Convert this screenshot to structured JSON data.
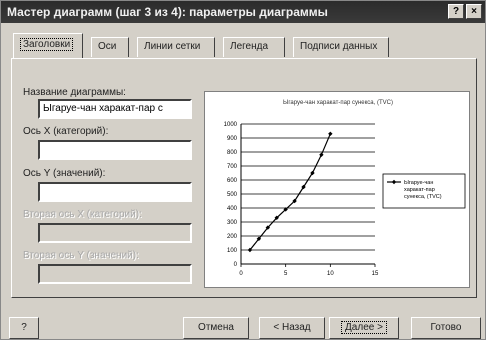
{
  "title": "Мастер диаграмм (шаг 3 из 4): параметры диаграммы",
  "title_buttons": {
    "help": "?",
    "close": "×"
  },
  "tabs": [
    {
      "label": "Заголовки",
      "active": true
    },
    {
      "label": "Оси"
    },
    {
      "label": "Линии сетки"
    },
    {
      "label": "Легенда"
    },
    {
      "label": "Подписи данных"
    }
  ],
  "fields": {
    "chart_title": {
      "label": "Название диаграммы:",
      "value": "Ыгаруе-чан харакат-пар с"
    },
    "x_axis": {
      "label": "Ось X (категорий):",
      "value": ""
    },
    "y_axis": {
      "label": "Ось Y (значений):",
      "value": ""
    },
    "x2_axis": {
      "label": "Вторая ось X (категорий):",
      "value": ""
    },
    "y2_axis": {
      "label": "Вторая ось Y (значений):",
      "value": ""
    }
  },
  "chart_data": {
    "type": "line",
    "title": "Ыгаруе-чан харакат-пар сунекса, (TVC)",
    "x": [
      1,
      2,
      3,
      4,
      5,
      6,
      7,
      8,
      9,
      10
    ],
    "series": [
      {
        "name": "Ыгаруе-чан харакат-пар сунекса, (TVC)",
        "values": [
          100,
          180,
          260,
          330,
          390,
          450,
          550,
          650,
          780,
          930
        ]
      }
    ],
    "xlim": [
      0,
      15
    ],
    "ylim": [
      0,
      1000
    ],
    "x_ticks": [
      "0",
      "5",
      "10",
      "15"
    ],
    "y_ticks": [
      "0",
      "100",
      "200",
      "300",
      "400",
      "500",
      "600",
      "700",
      "800",
      "900",
      "1000"
    ],
    "grid": true,
    "legend": "right",
    "line_color": "#000000"
  },
  "buttons": {
    "help": "?",
    "cancel": "Отмена",
    "back": "< Назад",
    "next": "Далее >",
    "finish": "Готово"
  }
}
